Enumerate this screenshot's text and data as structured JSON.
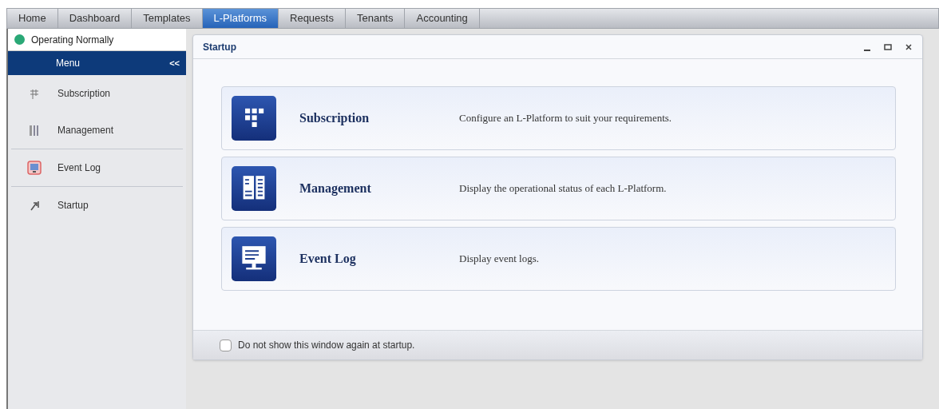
{
  "tabs": [
    {
      "label": "Home",
      "selected": false
    },
    {
      "label": "Dashboard",
      "selected": false
    },
    {
      "label": "Templates",
      "selected": false
    },
    {
      "label": "L-Platforms",
      "selected": true
    },
    {
      "label": "Requests",
      "selected": false
    },
    {
      "label": "Tenants",
      "selected": false
    },
    {
      "label": "Accounting",
      "selected": false
    }
  ],
  "status": {
    "label": "Operating Normally",
    "color": "#2aa876"
  },
  "sidebar": {
    "title": "Menu",
    "collapse": "<<",
    "items": [
      {
        "label": "Subscription",
        "kind": "grid",
        "divider_before": false
      },
      {
        "label": "Management",
        "kind": "bars",
        "divider_before": false
      },
      {
        "label": "Event Log",
        "kind": "monitor",
        "divider_before": true
      },
      {
        "label": "Startup",
        "kind": "arrow",
        "divider_before": true
      }
    ]
  },
  "dialog": {
    "title": "Startup",
    "cards": [
      {
        "title": "Subscription",
        "description": "Configure an L-Platform to suit your requirements.",
        "kind": "grid"
      },
      {
        "title": "Management",
        "description": "Display the operational status of each L-Platform.",
        "kind": "bars"
      },
      {
        "title": "Event Log",
        "description": "Display event logs.",
        "kind": "monitor"
      }
    ],
    "dont_show": {
      "label": "Do not show this window again at startup.",
      "checked": false
    }
  }
}
